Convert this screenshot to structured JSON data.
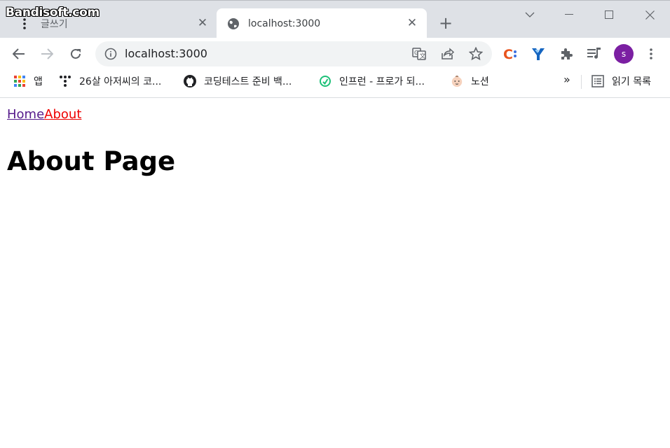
{
  "watermark": "Bandisoft.com",
  "tabs": [
    {
      "title": "글쓰기",
      "active": false,
      "icon": "more-vert-icon"
    },
    {
      "title": "localhost:3000",
      "active": true,
      "icon": "globe-icon"
    }
  ],
  "tab_close_glyph": "✕",
  "new_tab_glyph": "+",
  "omnibox": {
    "url": "localhost:3000"
  },
  "profile": {
    "initial": "s",
    "color": "#7b1fa2"
  },
  "bookmarks": [
    {
      "label": "앱",
      "icon": "apps-grid-icon"
    },
    {
      "label": "26살 아저씨의 코...",
      "icon": "dots-icon"
    },
    {
      "label": "코딩테스트 준비 백...",
      "icon": "github-icon"
    },
    {
      "label": "인프런 - 프로가 되...",
      "icon": "inflearn-icon"
    },
    {
      "label": "노션",
      "icon": "baby-face-icon"
    }
  ],
  "bookmarks_overflow": "»",
  "reading_list": {
    "label": "읽기 목록",
    "icon": "reading-list-icon"
  },
  "page": {
    "nav": {
      "home": "Home",
      "about": "About"
    },
    "heading": "About Page"
  },
  "colors": {
    "visited_link": "#551a8b",
    "active_link": "#ee0000",
    "titlebar_bg": "#dee1e6",
    "omnibox_bg": "#f1f3f4"
  }
}
